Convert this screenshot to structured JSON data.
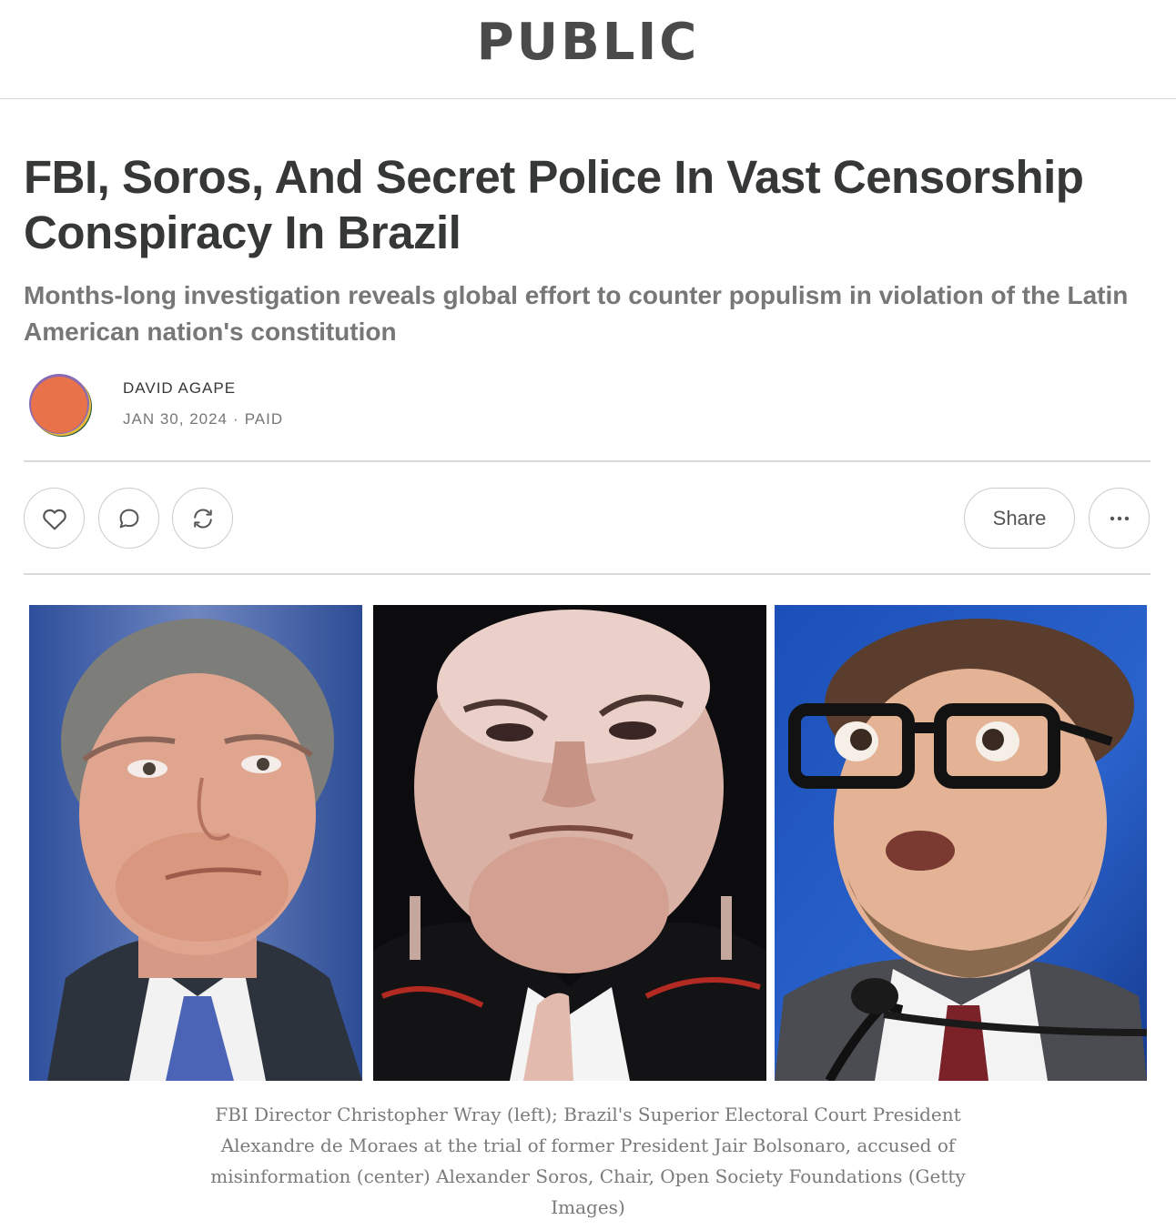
{
  "header": {
    "logo_text": "PUBLIC"
  },
  "article": {
    "title": "FBI, Soros, And Secret Police In Vast Censorship Conspiracy In Brazil",
    "subtitle": "Months-long investigation reveals global effort to counter populism in violation of the Latin American nation's constitution",
    "author": "DAVID AGAPE",
    "date": "JAN 30, 2024",
    "separator": "·",
    "access": "PAID"
  },
  "actions": {
    "like_icon": "heart-icon",
    "comment_icon": "comment-icon",
    "restack_icon": "restack-icon",
    "share_label": "Share",
    "more_icon": "ellipsis-icon"
  },
  "image": {
    "caption": "FBI Director Christopher Wray (left); Brazil's Superior Electoral Court President Alexandre de Moraes at the trial of former President Jair Bolsonaro, accused of misinformation (center) Alexander Soros, Chair, Open Society Foundations (Getty Images)"
  },
  "colors": {
    "text": "#363737",
    "muted": "#777777",
    "border": "#cccccc",
    "avatar_orange": "#e8734a"
  }
}
